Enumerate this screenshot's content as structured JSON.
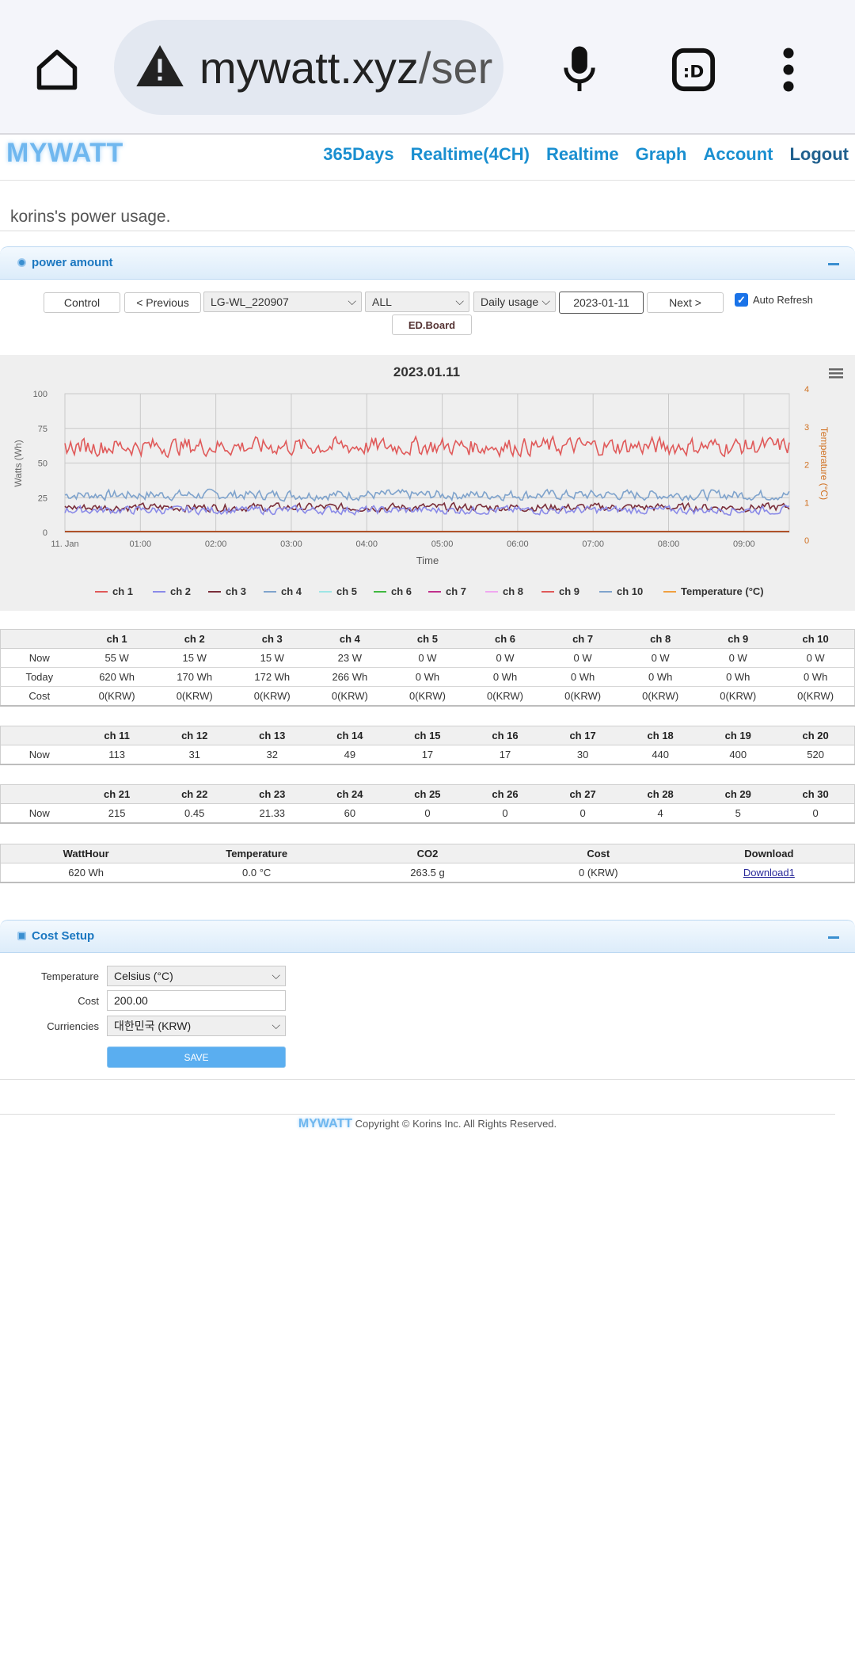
{
  "browser": {
    "url_host": "mywatt.xyz",
    "url_path": "/ser"
  },
  "header": {
    "logo": "MYWATT",
    "nav": [
      "365Days",
      "Realtime(4CH)",
      "Realtime",
      "Graph",
      "Account",
      "Logout"
    ]
  },
  "subtitle": "korins's power usage.",
  "panel_power": {
    "title": "power amount",
    "control_label": "Control",
    "prev_label": "< Previous",
    "device_value": "LG-WL_220907",
    "channel_value": "ALL",
    "mode_value": "Daily usage",
    "date_value": "2023-01-11",
    "next_label": "Next >",
    "auto_refresh_label": "Auto Refresh",
    "auto_refresh_checked": true,
    "edboard_label": "ED.Board"
  },
  "chart_data": {
    "type": "line",
    "title": "2023.01.11",
    "xlabel": "Time",
    "ylabel": "Watts (Wh)",
    "y2label": "Temperature (°C)",
    "ylim": [
      0,
      100
    ],
    "y2lim": [
      0,
      4
    ],
    "yticks": [
      "0",
      "25",
      "50",
      "75",
      "100"
    ],
    "y2ticks": [
      "0",
      "1",
      "2",
      "3",
      "4"
    ],
    "xticks": [
      "11. Jan",
      "01:00",
      "02:00",
      "03:00",
      "04:00",
      "05:00",
      "06:00",
      "07:00",
      "08:00",
      "09:00"
    ],
    "x_range_hours": [
      0,
      9.6
    ],
    "grid": true,
    "legend_placement": "bottom",
    "series": [
      {
        "name": "ch 1",
        "color": "#e05a5a",
        "mean": 62,
        "amp": 9
      },
      {
        "name": "ch 2",
        "color": "#8a8ae8",
        "mean": 16,
        "amp": 4
      },
      {
        "name": "ch 3",
        "color": "#7a2e3a",
        "mean": 18,
        "amp": 4
      },
      {
        "name": "ch 4",
        "color": "#7fa3cc",
        "mean": 27,
        "amp": 5
      },
      {
        "name": "ch 5",
        "color": "#9ee6e6",
        "mean": 0,
        "amp": 0
      },
      {
        "name": "ch 6",
        "color": "#3fb83f",
        "mean": 0,
        "amp": 0
      },
      {
        "name": "ch 7",
        "color": "#c0308c",
        "mean": 0,
        "amp": 0
      },
      {
        "name": "ch 8",
        "color": "#f0a8f0",
        "mean": 0,
        "amp": 0
      },
      {
        "name": "ch 9",
        "color": "#e05a5a",
        "mean": 0,
        "amp": 0
      },
      {
        "name": "ch 10",
        "color": "#7fa3cc",
        "mean": 0,
        "amp": 0
      },
      {
        "name": "Temperature (°C)",
        "color": "#f0a040",
        "mean": 0,
        "amp": 0
      }
    ]
  },
  "table1": {
    "headers": [
      "",
      "ch 1",
      "ch 2",
      "ch 3",
      "ch 4",
      "ch 5",
      "ch 6",
      "ch 7",
      "ch 8",
      "ch 9",
      "ch 10"
    ],
    "rows": [
      [
        "Now",
        "55 W",
        "15 W",
        "15 W",
        "23 W",
        "0 W",
        "0 W",
        "0 W",
        "0 W",
        "0 W",
        "0 W"
      ],
      [
        "Today",
        "620 Wh",
        "170 Wh",
        "172 Wh",
        "266 Wh",
        "0 Wh",
        "0 Wh",
        "0 Wh",
        "0 Wh",
        "0 Wh",
        "0 Wh"
      ],
      [
        "Cost",
        "0(KRW)",
        "0(KRW)",
        "0(KRW)",
        "0(KRW)",
        "0(KRW)",
        "0(KRW)",
        "0(KRW)",
        "0(KRW)",
        "0(KRW)",
        "0(KRW)"
      ]
    ]
  },
  "table2": {
    "headers": [
      "",
      "ch 11",
      "ch 12",
      "ch 13",
      "ch 14",
      "ch 15",
      "ch 16",
      "ch 17",
      "ch 18",
      "ch 19",
      "ch 20"
    ],
    "rows": [
      [
        "Now",
        "113",
        "31",
        "32",
        "49",
        "17",
        "17",
        "30",
        "440",
        "400",
        "520"
      ]
    ]
  },
  "table3": {
    "headers": [
      "",
      "ch 21",
      "ch 22",
      "ch 23",
      "ch 24",
      "ch 25",
      "ch 26",
      "ch 27",
      "ch 28",
      "ch 29",
      "ch 30"
    ],
    "rows": [
      [
        "Now",
        "215",
        "0.45",
        "21.33",
        "60",
        "0",
        "0",
        "0",
        "4",
        "5",
        "0"
      ]
    ]
  },
  "summary": {
    "headers": [
      "WattHour",
      "Temperature",
      "CO2",
      "Cost",
      "Download"
    ],
    "values": [
      "620 Wh",
      "0.0 °C",
      "263.5 g",
      "0 (KRW)",
      "Download1"
    ]
  },
  "panel_cost": {
    "title": "Cost Setup",
    "temp_label": "Temperature",
    "temp_value": "Celsius (°C)",
    "cost_label": "Cost",
    "cost_value": "200.00",
    "currency_label": "Curriencies",
    "currency_value": "대한민국 (KRW)",
    "save_label": "SAVE"
  },
  "footer": {
    "logo": "MYWATT",
    "copyright": "Copyright © Korins Inc. All Rights Reserved."
  }
}
